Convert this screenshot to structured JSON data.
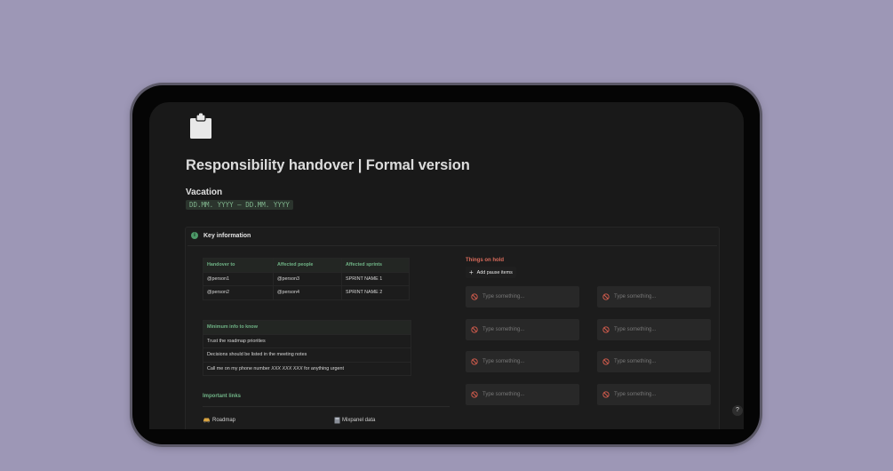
{
  "page": {
    "title": "Responsibility handover | Formal version",
    "page_icon": "clipboard-icon"
  },
  "vacation": {
    "heading": "Vacation",
    "date_range": "DD.MM. YYYY – DD.MM. YYYY"
  },
  "callout": {
    "icon": "info-icon",
    "title": "Key information"
  },
  "handover_table": {
    "headers": [
      "Handover to",
      "Affected people",
      "Affected sprints"
    ],
    "rows": [
      [
        "@person1",
        "@person3",
        "SPRINT NAME 1"
      ],
      [
        "@person2",
        "@person4",
        "SPRINT NAME 2"
      ]
    ]
  },
  "info_table": {
    "header": "Minimum info to know",
    "rows": [
      "Trust the roadmap priorities",
      "Decisions should be listed in the meeting notes"
    ],
    "phone_row": {
      "before": "Call me on my phone number ",
      "number": "XXX XXX XXX",
      "after": " for anything urgent"
    }
  },
  "links": {
    "heading": "Important links",
    "items": [
      {
        "icon": "car-icon",
        "label": "Roadmap"
      },
      {
        "icon": "book-icon",
        "label": "Mixpanel data"
      }
    ]
  },
  "hold": {
    "heading": "Things on hold",
    "add_button_label": "Add pause items",
    "item_placeholder": "Type something...",
    "item_icon": "ban-icon",
    "item_count": 8
  },
  "help": {
    "label": "?"
  },
  "colors": {
    "background": "#9d97b6",
    "accent_green": "#6fb285",
    "accent_red": "#d96b5b",
    "surface": "#191919"
  }
}
